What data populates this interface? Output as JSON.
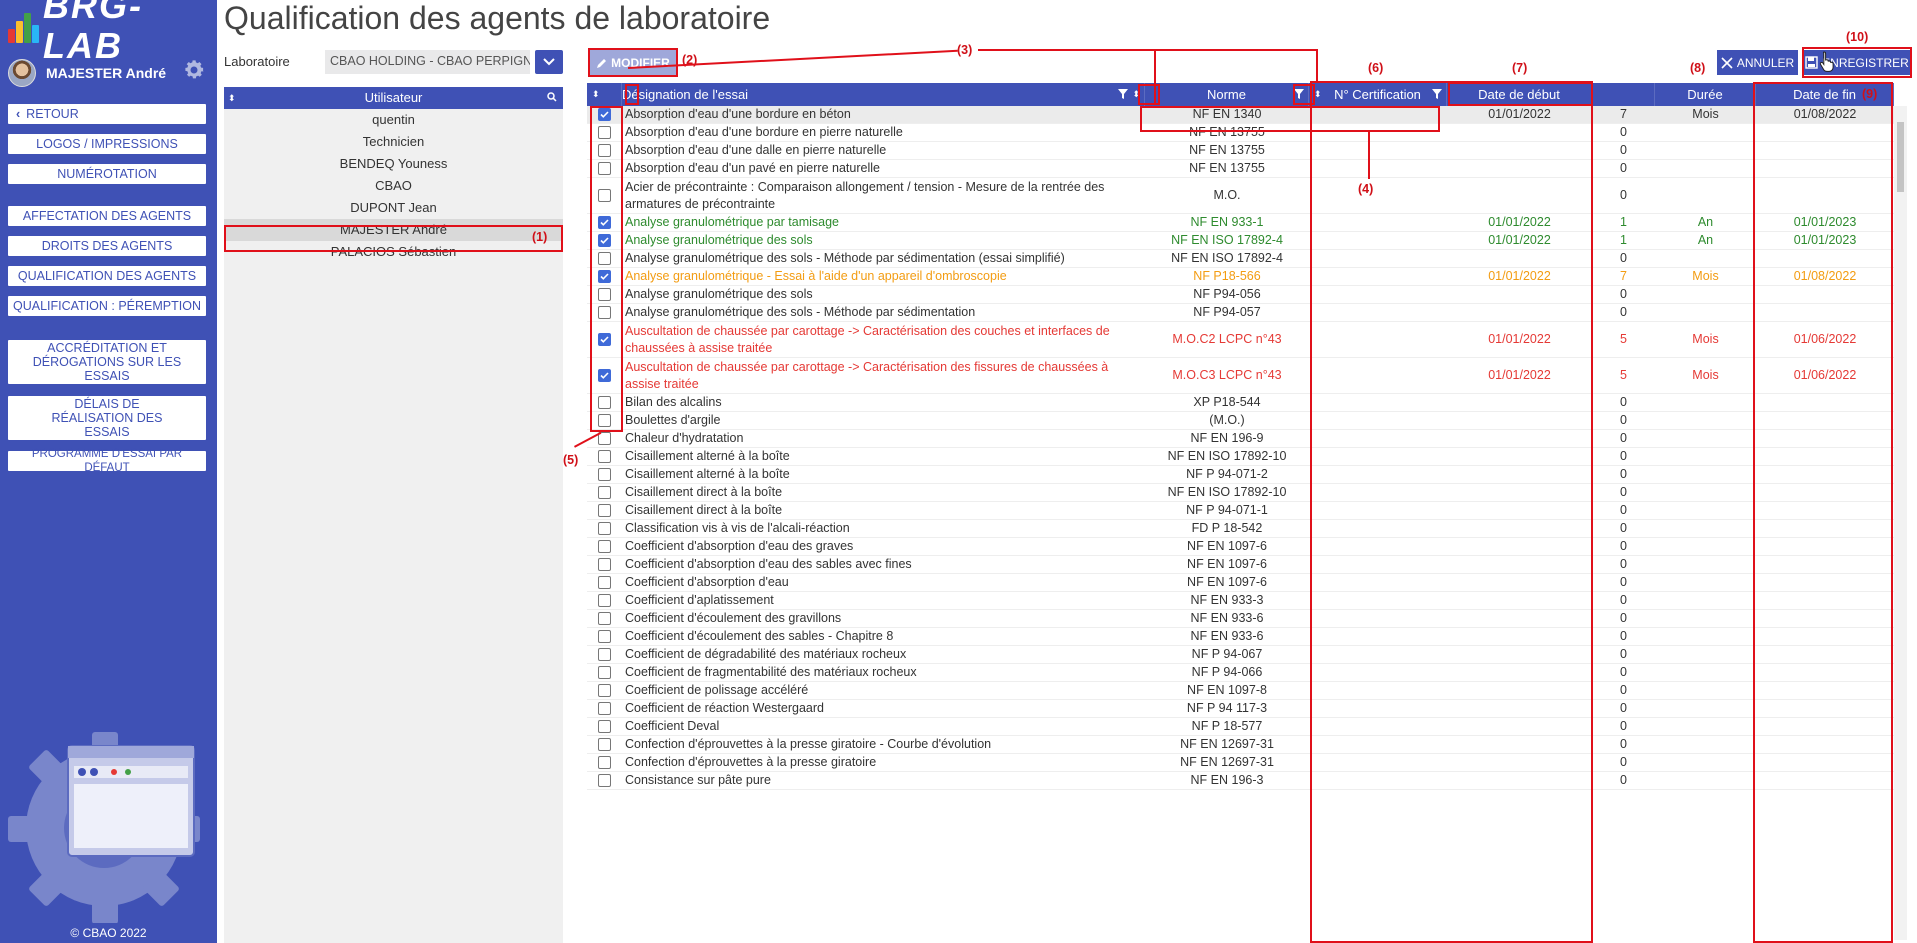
{
  "app": {
    "brand": "BRG-LAB",
    "copyright": "© CBAO 2022"
  },
  "sidebar": {
    "user_name": "MAJESTER André",
    "nav": [
      {
        "label": "RETOUR"
      },
      {
        "label": "LOGOS / IMPRESSIONS"
      },
      {
        "label": "NUMÉROTATION"
      },
      {
        "label": "AFFECTATION DES AGENTS"
      },
      {
        "label": "DROITS DES AGENTS"
      },
      {
        "label": "QUALIFICATION DES AGENTS"
      },
      {
        "label": "QUALIFICATION : PÉREMPTION"
      },
      {
        "label": "ACCRÉDITATION ET DÉROGATIONS SUR LES ESSAIS"
      },
      {
        "label": "DÉLAIS DE RÉALISATION DES ESSAIS"
      },
      {
        "label": "PROGRAMME D'ESSAI PAR DÉFAUT"
      }
    ]
  },
  "page": {
    "title": "Qualification des agents de laboratoire"
  },
  "lab": {
    "label": "Laboratoire",
    "value": "CBAO HOLDING - CBAO PERPIGNAN"
  },
  "users": {
    "header": "Utilisateur",
    "items": [
      "quentin",
      "Technicien",
      "BENDEQ Youness",
      "CBAO",
      "DUPONT Jean",
      "MAJESTER André",
      "PALACIOS Sébastien"
    ],
    "selected": 5
  },
  "toolbar": {
    "modifier": "MODIFIER",
    "annuler": "ANNULER",
    "enregistrer": "ENREGISTRER"
  },
  "table": {
    "columns": [
      "Désignation de l'essai",
      "Norme",
      "N° Certification",
      "Date de début",
      "",
      "Durée",
      "Date de fin"
    ],
    "rows": [
      {
        "checked": true,
        "status": "normal",
        "hl": true,
        "name": "Absorption d'eau d'une bordure en béton",
        "norme": "NF EN 1340",
        "cert": "",
        "debut": "01/01/2022",
        "n": "7",
        "duree": "Mois",
        "fin": "01/08/2022"
      },
      {
        "checked": false,
        "status": "normal",
        "name": "Absorption d'eau d'une bordure en pierre naturelle",
        "norme": "NF EN 13755",
        "cert": "",
        "debut": "",
        "n": "0",
        "duree": "",
        "fin": ""
      },
      {
        "checked": false,
        "status": "normal",
        "name": "Absorption d'eau d'une dalle en pierre naturelle",
        "norme": "NF EN 13755",
        "cert": "",
        "debut": "",
        "n": "0",
        "duree": "",
        "fin": ""
      },
      {
        "checked": false,
        "status": "normal",
        "name": "Absorption d'eau d'un pavé en pierre naturelle",
        "norme": "NF EN 13755",
        "cert": "",
        "debut": "",
        "n": "0",
        "duree": "",
        "fin": ""
      },
      {
        "checked": false,
        "status": "normal",
        "tall": true,
        "name": "Acier de précontrainte : Comparaison allongement / tension - Mesure de la rentrée des armatures de précontrainte",
        "norme": "M.O.",
        "cert": "",
        "debut": "",
        "n": "0",
        "duree": "",
        "fin": ""
      },
      {
        "checked": true,
        "status": "green",
        "name": "Analyse granulométrique par tamisage",
        "norme": "NF EN 933-1",
        "cert": "",
        "debut": "01/01/2022",
        "n": "1",
        "duree": "An",
        "fin": "01/01/2023"
      },
      {
        "checked": true,
        "status": "green",
        "name": "Analyse granulométrique des sols",
        "norme": "NF EN ISO 17892-4",
        "cert": "",
        "debut": "01/01/2022",
        "n": "1",
        "duree": "An",
        "fin": "01/01/2023"
      },
      {
        "checked": false,
        "status": "normal",
        "name": "Analyse granulométrique des sols - Méthode par sédimentation (essai simplifié)",
        "norme": "NF EN ISO 17892-4",
        "cert": "",
        "debut": "",
        "n": "0",
        "duree": "",
        "fin": ""
      },
      {
        "checked": true,
        "status": "orange",
        "name": "Analyse granulométrique - Essai à l'aide d'un appareil d'ombroscopie",
        "norme": "NF P18-566",
        "cert": "",
        "debut": "01/01/2022",
        "n": "7",
        "duree": "Mois",
        "fin": "01/08/2022"
      },
      {
        "checked": false,
        "status": "normal",
        "name": "Analyse granulométrique des sols",
        "norme": "NF P94-056",
        "cert": "",
        "debut": "",
        "n": "0",
        "duree": "",
        "fin": ""
      },
      {
        "checked": false,
        "status": "normal",
        "name": "Analyse granulométrique des sols - Méthode par sédimentation",
        "norme": "NF P94-057",
        "cert": "",
        "debut": "",
        "n": "0",
        "duree": "",
        "fin": ""
      },
      {
        "checked": true,
        "status": "red",
        "tall": true,
        "name": "Auscultation de chaussée par carottage -> Caractérisation des couches et interfaces de chaussées à assise traitée",
        "norme": "M.O.C2 LCPC n°43",
        "cert": "",
        "debut": "01/01/2022",
        "n": "5",
        "duree": "Mois",
        "fin": "01/06/2022"
      },
      {
        "checked": true,
        "status": "red",
        "tall": true,
        "name": "Auscultation de chaussée par carottage -> Caractérisation des fissures de chaussées à assise traitée",
        "norme": "M.O.C3 LCPC n°43",
        "cert": "",
        "debut": "01/01/2022",
        "n": "5",
        "duree": "Mois",
        "fin": "01/06/2022"
      },
      {
        "checked": false,
        "status": "normal",
        "name": "Bilan des alcalins",
        "norme": "XP P18-544",
        "cert": "",
        "debut": "",
        "n": "0",
        "duree": "",
        "fin": ""
      },
      {
        "checked": false,
        "status": "normal",
        "name": "Boulettes d'argile",
        "norme": "(M.O.)",
        "cert": "",
        "debut": "",
        "n": "0",
        "duree": "",
        "fin": ""
      },
      {
        "checked": false,
        "status": "normal",
        "name": "Chaleur d'hydratation",
        "norme": "NF EN 196-9",
        "cert": "",
        "debut": "",
        "n": "0",
        "duree": "",
        "fin": ""
      },
      {
        "checked": false,
        "status": "normal",
        "name": "Cisaillement alterné à la boîte",
        "norme": "NF EN ISO 17892-10",
        "cert": "",
        "debut": "",
        "n": "0",
        "duree": "",
        "fin": ""
      },
      {
        "checked": false,
        "status": "normal",
        "name": "Cisaillement alterné à la boîte",
        "norme": "NF P 94-071-2",
        "cert": "",
        "debut": "",
        "n": "0",
        "duree": "",
        "fin": ""
      },
      {
        "checked": false,
        "status": "normal",
        "name": "Cisaillement direct à la boîte",
        "norme": "NF EN ISO 17892-10",
        "cert": "",
        "debut": "",
        "n": "0",
        "duree": "",
        "fin": ""
      },
      {
        "checked": false,
        "status": "normal",
        "name": "Cisaillement direct à la boîte",
        "norme": "NF P 94-071-1",
        "cert": "",
        "debut": "",
        "n": "0",
        "duree": "",
        "fin": ""
      },
      {
        "checked": false,
        "status": "normal",
        "name": "Classification vis à vis de l'alcali-réaction",
        "norme": "FD P 18-542",
        "cert": "",
        "debut": "",
        "n": "0",
        "duree": "",
        "fin": ""
      },
      {
        "checked": false,
        "status": "normal",
        "name": "Coefficient d'absorption d'eau des graves",
        "norme": "NF EN 1097-6",
        "cert": "",
        "debut": "",
        "n": "0",
        "duree": "",
        "fin": ""
      },
      {
        "checked": false,
        "status": "normal",
        "name": "Coefficient d'absorption d'eau des sables avec fines",
        "norme": "NF EN 1097-6",
        "cert": "",
        "debut": "",
        "n": "0",
        "duree": "",
        "fin": ""
      },
      {
        "checked": false,
        "status": "normal",
        "name": "Coefficient d'absorption d'eau",
        "norme": "NF EN 1097-6",
        "cert": "",
        "debut": "",
        "n": "0",
        "duree": "",
        "fin": ""
      },
      {
        "checked": false,
        "status": "normal",
        "name": "Coefficient d'aplatissement",
        "norme": "NF EN 933-3",
        "cert": "",
        "debut": "",
        "n": "0",
        "duree": "",
        "fin": ""
      },
      {
        "checked": false,
        "status": "normal",
        "name": "Coefficient d'écoulement des gravillons",
        "norme": "NF EN 933-6",
        "cert": "",
        "debut": "",
        "n": "0",
        "duree": "",
        "fin": ""
      },
      {
        "checked": false,
        "status": "normal",
        "name": "Coefficient d'écoulement des sables - Chapitre 8",
        "norme": "NF EN 933-6",
        "cert": "",
        "debut": "",
        "n": "0",
        "duree": "",
        "fin": ""
      },
      {
        "checked": false,
        "status": "normal",
        "name": "Coefficient de dégradabilité des matériaux rocheux",
        "norme": "NF P 94-067",
        "cert": "",
        "debut": "",
        "n": "0",
        "duree": "",
        "fin": ""
      },
      {
        "checked": false,
        "status": "normal",
        "name": "Coefficient de fragmentabilité des matériaux rocheux",
        "norme": "NF P 94-066",
        "cert": "",
        "debut": "",
        "n": "0",
        "duree": "",
        "fin": ""
      },
      {
        "checked": false,
        "status": "normal",
        "name": "Coefficient de polissage accéléré",
        "norme": "NF EN 1097-8",
        "cert": "",
        "debut": "",
        "n": "0",
        "duree": "",
        "fin": ""
      },
      {
        "checked": false,
        "status": "normal",
        "name": "Coefficient de réaction Westergaard",
        "norme": "NF P 94 117-3",
        "cert": "",
        "debut": "",
        "n": "0",
        "duree": "",
        "fin": ""
      },
      {
        "checked": false,
        "status": "normal",
        "name": "Coefficient Deval",
        "norme": "NF P 18-577",
        "cert": "",
        "debut": "",
        "n": "0",
        "duree": "",
        "fin": ""
      },
      {
        "checked": false,
        "status": "normal",
        "name": "Confection d'éprouvettes à la presse giratoire - Courbe d'évolution",
        "norme": "NF EN 12697-31",
        "cert": "",
        "debut": "",
        "n": "0",
        "duree": "",
        "fin": ""
      },
      {
        "checked": false,
        "status": "normal",
        "name": "Confection d'éprouvettes à la presse giratoire",
        "norme": "NF EN 12697-31",
        "cert": "",
        "debut": "",
        "n": "0",
        "duree": "",
        "fin": ""
      },
      {
        "checked": false,
        "status": "normal",
        "name": "Consistance sur pâte pure",
        "norme": "NF EN 196-3",
        "cert": "",
        "debut": "",
        "n": "0",
        "duree": "",
        "fin": ""
      }
    ]
  },
  "annotations": [
    "(1)",
    "(2)",
    "(3)",
    "(4)",
    "(5)",
    "(6)",
    "(7)",
    "(8)",
    "(9)",
    "(10)"
  ],
  "colors": {
    "primary": "#3f51b5",
    "annotation": "#e0101a",
    "green": "#2e8b2e",
    "orange": "#f39c12",
    "red": "#e53935"
  }
}
